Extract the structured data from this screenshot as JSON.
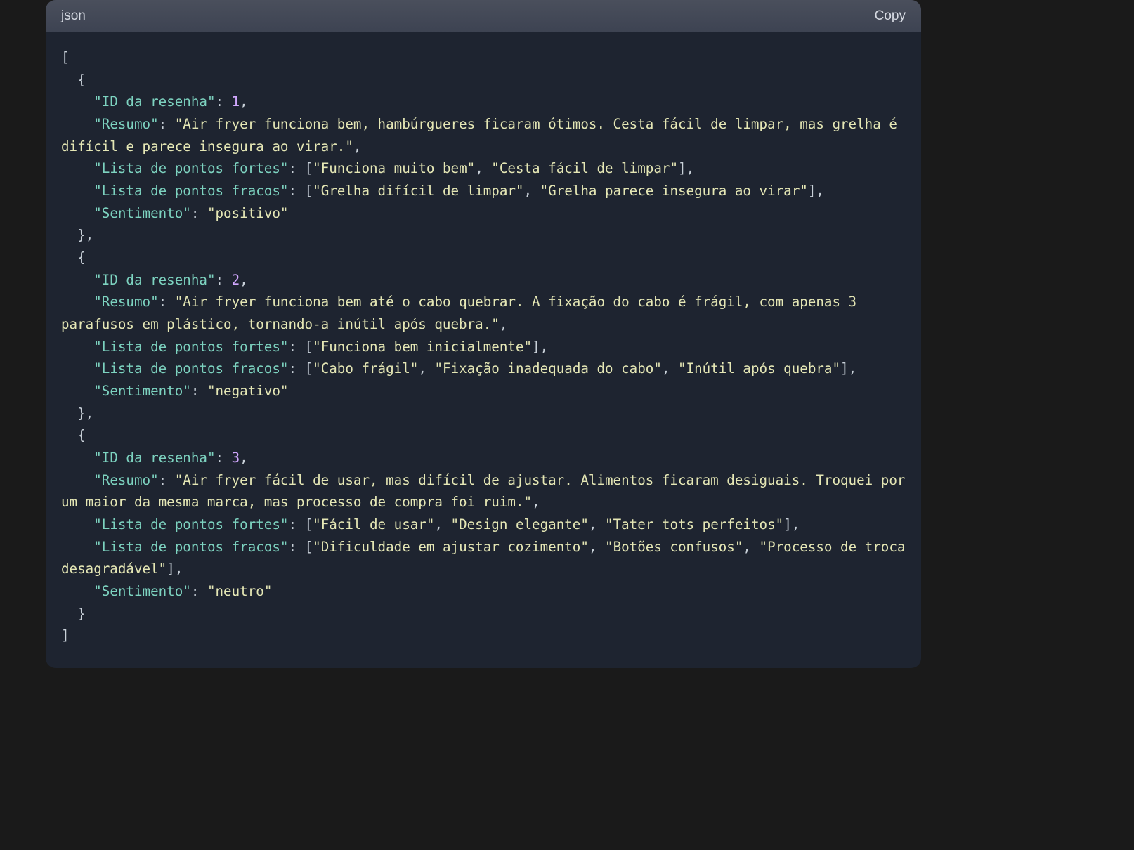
{
  "header": {
    "language": "json",
    "copy_label": "Copy"
  },
  "json_content": [
    {
      "ID da resenha": 1,
      "Resumo": "Air fryer funciona bem, hambúrgueres ficaram ótimos. Cesta fácil de limpar, mas grelha é difícil e parece insegura ao virar.",
      "Lista de pontos fortes": [
        "Funciona muito bem",
        "Cesta fácil de limpar"
      ],
      "Lista de pontos fracos": [
        "Grelha difícil de limpar",
        "Grelha parece insegura ao virar"
      ],
      "Sentimento": "positivo"
    },
    {
      "ID da resenha": 2,
      "Resumo": "Air fryer funciona bem até o cabo quebrar. A fixação do cabo é frágil, com apenas 3 parafusos em plástico, tornando-a inútil após quebra.",
      "Lista de pontos fortes": [
        "Funciona bem inicialmente"
      ],
      "Lista de pontos fracos": [
        "Cabo frágil",
        "Fixação inadequada do cabo",
        "Inútil após quebra"
      ],
      "Sentimento": "negativo"
    },
    {
      "ID da resenha": 3,
      "Resumo": "Air fryer fácil de usar, mas difícil de ajustar. Alimentos ficaram desiguais. Troquei por um maior da mesma marca, mas processo de compra foi ruim.",
      "Lista de pontos fortes": [
        "Fácil de usar",
        "Design elegante",
        "Tater tots perfeitos"
      ],
      "Lista de pontos fracos": [
        "Dificuldade em ajustar cozimento",
        "Botões confusos",
        "Processo de troca desagradável"
      ],
      "Sentimento": "neutro"
    }
  ]
}
